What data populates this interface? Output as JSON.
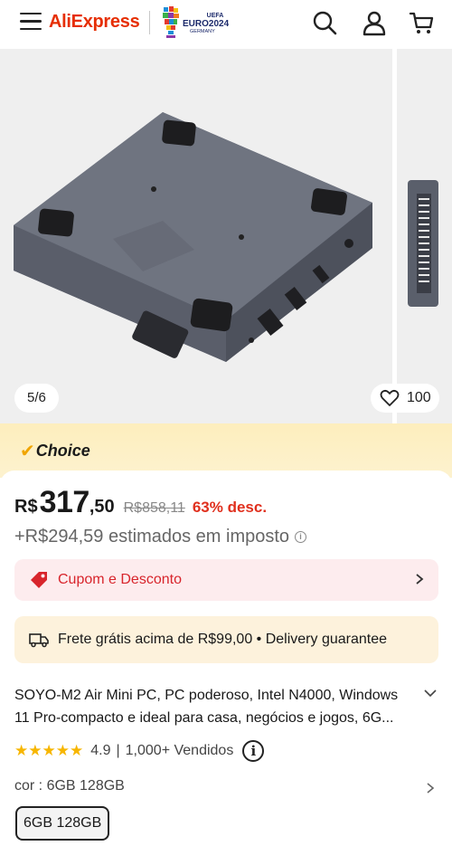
{
  "header": {
    "brand": "AliExpress",
    "partner": {
      "small": "UEFA",
      "main": "EURO2024",
      "sub": "GERMANY"
    },
    "icons": [
      "menu-icon",
      "search-icon",
      "user-icon",
      "cart-icon"
    ]
  },
  "gallery": {
    "page_indicator": "5/6",
    "wishlist_count": "100"
  },
  "choice": {
    "label": "Choice"
  },
  "price": {
    "currency": "R$",
    "integer": "317",
    "decimal": ",50",
    "original": "R$858,11",
    "discount": "63% desc.",
    "tax_note": "+R$294,59 estimados em imposto"
  },
  "coupon": {
    "label": "Cupom e Desconto"
  },
  "shipping": {
    "label": "Frete grátis acima de R$99,00 • Delivery guarantee"
  },
  "product": {
    "title": "SOYO-M2 Air Mini PC, PC poderoso, Intel N4000, Windows 11 Pro-compacto e ideal para casa, negócios e jogos, 6G...",
    "rating": "4.9",
    "rating_separator": "|",
    "sold": "1,000+ Vendidos",
    "stars": 5
  },
  "variant": {
    "label": "cor : 6GB 128GB",
    "selected_chip": "6GB 128GB"
  },
  "colors": {
    "brand": "#e62e04",
    "discount": "#e0301e",
    "coupon_bg": "#fdecee",
    "shipping_bg": "#fdf2dc",
    "star": "#f7b600"
  }
}
